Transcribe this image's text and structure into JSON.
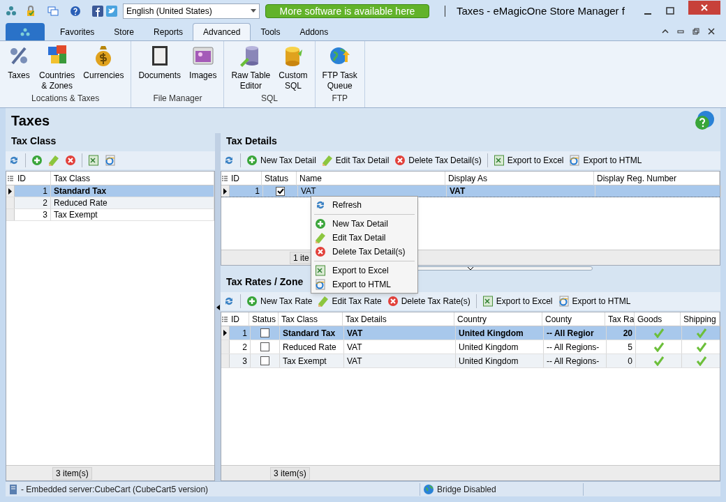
{
  "title_bar": {
    "language": "English (United States)",
    "promo": "More software is available here",
    "title": "Taxes - eMagicOne Store Manager f"
  },
  "ribbon_tabs": [
    {
      "label": "Favorites",
      "selected": false
    },
    {
      "label": "Store",
      "selected": false
    },
    {
      "label": "Reports",
      "selected": false
    },
    {
      "label": "Advanced",
      "selected": true
    },
    {
      "label": "Tools",
      "selected": false
    },
    {
      "label": "Addons",
      "selected": false
    }
  ],
  "ribbon_groups": [
    {
      "label": "Locations & Taxes",
      "items": [
        {
          "lines": [
            "Taxes"
          ]
        },
        {
          "lines": [
            "Countries",
            "& Zones"
          ]
        },
        {
          "lines": [
            "Currencies"
          ]
        }
      ]
    },
    {
      "label": "File Manager",
      "items": [
        {
          "lines": [
            "Documents"
          ]
        },
        {
          "lines": [
            "Images"
          ]
        }
      ]
    },
    {
      "label": "SQL",
      "items": [
        {
          "lines": [
            "Raw Table",
            "Editor"
          ]
        },
        {
          "lines": [
            "Custom",
            "SQL"
          ]
        }
      ]
    },
    {
      "label": "FTP",
      "items": [
        {
          "lines": [
            "FTP Task",
            "Queue"
          ]
        }
      ]
    }
  ],
  "page_title": "Taxes",
  "tax_class": {
    "title": "Tax Class",
    "columns": [
      "ID",
      "Tax Class"
    ],
    "rows": [
      {
        "id": "1",
        "name": "Standard Tax",
        "selected": true
      },
      {
        "id": "2",
        "name": "Reduced Rate",
        "selected": false
      },
      {
        "id": "3",
        "name": "Tax Exempt",
        "selected": false
      }
    ],
    "footer": "3 item(s)"
  },
  "tax_details": {
    "title": "Tax Details",
    "toolbar": [
      "New Tax Detail",
      "Edit Tax Detail",
      "Delete Tax Detail(s)",
      "Export to Excel",
      "Export to HTML"
    ],
    "columns": [
      "ID",
      "Status",
      "Name",
      "Display As",
      "Display Reg. Number"
    ],
    "rows": [
      {
        "id": "1",
        "checked": true,
        "name": "VAT",
        "display_as": "VAT",
        "selected": true
      }
    ],
    "footer": "1 ite"
  },
  "context_menu": [
    {
      "kind": "item",
      "label": "Refresh"
    },
    {
      "kind": "separator"
    },
    {
      "kind": "item",
      "label": "New Tax Detail"
    },
    {
      "kind": "item",
      "label": "Edit Tax Detail"
    },
    {
      "kind": "item",
      "label": "Delete Tax Detail(s)"
    },
    {
      "kind": "separator"
    },
    {
      "kind": "item",
      "label": "Export to Excel"
    },
    {
      "kind": "item",
      "label": "Export to HTML"
    }
  ],
  "tax_rates": {
    "title": "Tax Rates / Zone",
    "toolbar": [
      "New Tax Rate",
      "Edit Tax Rate",
      "Delete Tax Rate(s)",
      "Export to Excel",
      "Export to HTML"
    ],
    "columns": [
      "ID",
      "Status",
      "Tax Class",
      "Tax Details",
      "Country",
      "County",
      "Tax Ra",
      "Goods",
      "Shipping"
    ],
    "rows": [
      {
        "id": "1",
        "checked": false,
        "tax_class": "Standard Tax",
        "tax_details": "VAT",
        "country": "United Kingdom",
        "county": "-- All Regior",
        "rate": "20",
        "goods": true,
        "shipping": true,
        "selected": true
      },
      {
        "id": "2",
        "checked": false,
        "tax_class": "Reduced Rate",
        "tax_details": "VAT",
        "country": "United Kingdom",
        "county": "-- All Regions-",
        "rate": "5",
        "goods": true,
        "shipping": true,
        "selected": false
      },
      {
        "id": "3",
        "checked": false,
        "tax_class": "Tax Exempt",
        "tax_details": "VAT",
        "country": "United Kingdom",
        "county": "-- All Regions-",
        "rate": "0",
        "goods": true,
        "shipping": true,
        "selected": false
      }
    ],
    "footer": "3 item(s)"
  },
  "status_bar": {
    "server": "- Embedded server:CubeCart (CubeCart5 version)",
    "bridge": "Bridge Disabled"
  }
}
